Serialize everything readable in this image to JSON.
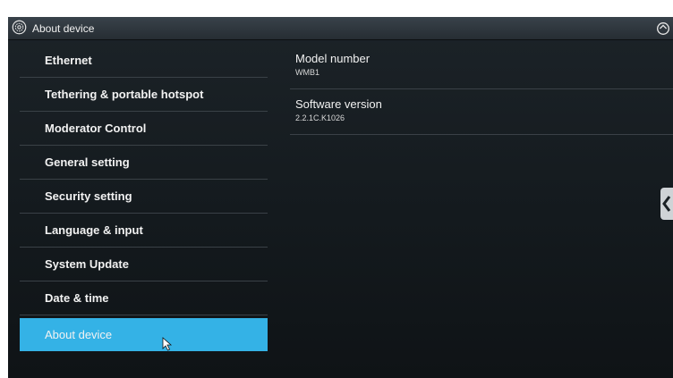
{
  "titlebar": {
    "title": "About device"
  },
  "sidebar": {
    "items": [
      {
        "label": "Ethernet"
      },
      {
        "label": "Tethering & portable hotspot"
      },
      {
        "label": "Moderator Control"
      },
      {
        "label": "General setting"
      },
      {
        "label": "Security setting"
      },
      {
        "label": "Language & input"
      },
      {
        "label": "System Update"
      },
      {
        "label": "Date & time"
      },
      {
        "label": "About device",
        "selected": true
      }
    ]
  },
  "details": {
    "items": [
      {
        "label": "Model number",
        "value": "WMB1"
      },
      {
        "label": "Software version",
        "value": "2.2.1C.K1026"
      }
    ]
  },
  "colors": {
    "accent": "#34b2e6",
    "background": "#161c20"
  },
  "icons": {
    "title": "settings-gear-icon",
    "top_right": "rotate-icon",
    "side_tab": "chevron-left-icon",
    "pointer": "mouse-pointer-icon"
  }
}
